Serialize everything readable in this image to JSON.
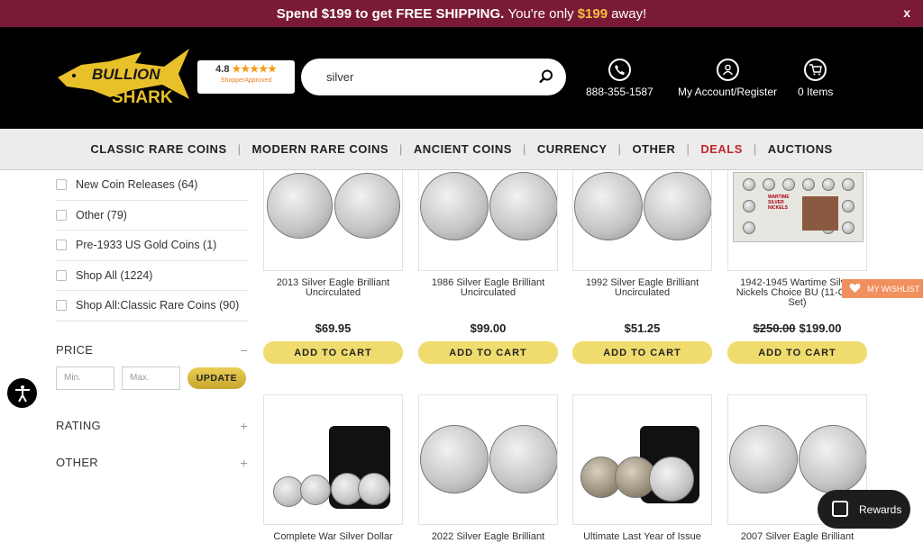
{
  "promo": {
    "pre": "Spend $199 to get FREE SHIPPING.",
    "mid": "You're only",
    "amount": "$199",
    "post": "away!",
    "close": "x"
  },
  "header": {
    "logo_text": "BULLION SHARK",
    "rating": {
      "score": "4.8",
      "stars": "★★★★★",
      "brand": "ShopperApproved"
    },
    "search": {
      "value": "silver"
    },
    "phone": "888-355-1587",
    "account": "My Account/Register",
    "cart": "0 Items"
  },
  "nav": [
    "CLASSIC RARE COINS",
    "MODERN RARE COINS",
    "ANCIENT COINS",
    "CURRENCY",
    "OTHER",
    "DEALS",
    "AUCTIONS"
  ],
  "sidebar": {
    "categories": [
      "New Coin Releases (64)",
      "Other (79)",
      "Pre-1933 US Gold Coins (1)",
      "Shop All (1224)",
      "Shop All:Classic Rare Coins (90)"
    ],
    "price_title": "PRICE",
    "price_toggle": "−",
    "min_placeholder": "Min.",
    "max_placeholder": "Max.",
    "update": "UPDATE",
    "rating_title": "RATING",
    "other_title": "OTHER",
    "plus": "+"
  },
  "products_row1": [
    {
      "name": "2013 Silver Eagle Brilliant Uncirculated",
      "price": "$69.95",
      "old_price": "",
      "cart": "ADD TO CART"
    },
    {
      "name": "1986 Silver Eagle Brilliant Uncirculated",
      "price": "$99.00",
      "old_price": "",
      "cart": "ADD TO CART"
    },
    {
      "name": "1992 Silver Eagle Brilliant Uncirculated",
      "price": "$51.25",
      "old_price": "",
      "cart": "ADD TO CART"
    },
    {
      "name": "1942-1945 Wartime Silver Nickels Choice BU (11-Coin Set)",
      "price": "$199.00",
      "old_price": "$250.00",
      "cart": "ADD TO CART"
    }
  ],
  "products_row2": [
    {
      "name": "Complete War Silver Dollar"
    },
    {
      "name": "2022 Silver Eagle Brilliant"
    },
    {
      "name": "Ultimate Last Year of Issue"
    },
    {
      "name": "2007 Silver Eagle Brilliant"
    }
  ],
  "wartime_label": "WARTIME SILVER NICKELS",
  "wishlist": "MY WISHLIST",
  "rewards": "Rewards"
}
